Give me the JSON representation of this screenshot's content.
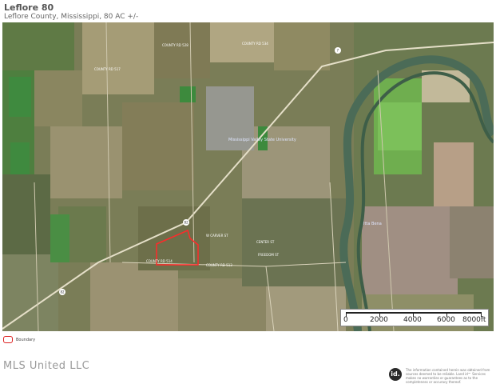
{
  "header": {
    "title": "Leflore 80",
    "subtitle": "Leflore County, Mississippi, 80 AC +/-"
  },
  "map": {
    "road_labels": [
      "COUNTY RD 514",
      "W CARVER ST",
      "CENTER ST",
      "FREEDOM ST",
      "COUNTY RD 517",
      "COUNTY RD 528",
      "COUNTY RD 534",
      "COUNTY RD 513"
    ],
    "town_labels": [
      "Mississippi Valley State University",
      "Itta Bena"
    ],
    "highway_shields": [
      "82",
      "82",
      "7"
    ],
    "scale": {
      "labels": [
        "0",
        "2000",
        "4000",
        "6000",
        "8000ft"
      ]
    }
  },
  "legend": {
    "boundary_label": "Boundary"
  },
  "footer": {
    "brand": "MLS United LLC",
    "logo_text": "id.",
    "disclaimer": "The information contained herein was obtained from sources deemed to be reliable. Land id™ Services makes no warranties or guarantees as to the completeness or accuracy thereof."
  },
  "colors": {
    "boundary": "#ff2a2a",
    "river": "#4b6b57"
  }
}
